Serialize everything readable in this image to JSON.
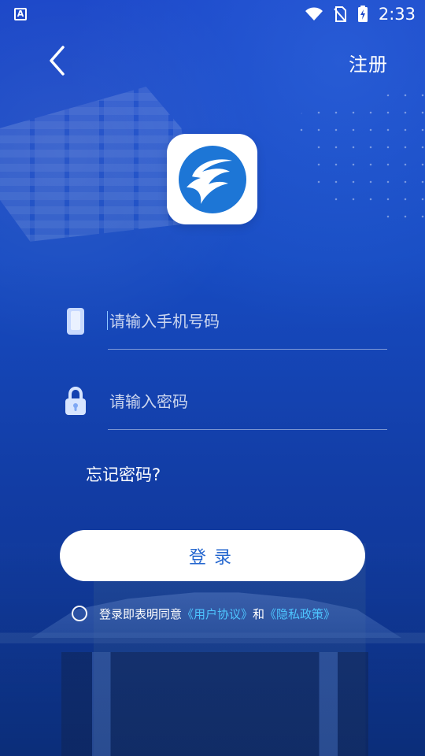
{
  "status_bar": {
    "app_icon": "A",
    "time": "2:33"
  },
  "header": {
    "register_label": "注册"
  },
  "brand": {
    "logo_icon": "swoosh-logo"
  },
  "form": {
    "phone_placeholder": "请输入手机号码",
    "password_placeholder": "请输入密码",
    "forgot_password_label": "忘记密码?",
    "login_button_label": "登录"
  },
  "agreement": {
    "prefix": "登录即表明同意",
    "user_agreement": "《用户协议》",
    "conjunction": "和",
    "privacy_policy": "《隐私政策》"
  },
  "colors": {
    "background_top": "#1a46c8",
    "background_bottom": "#0e3692",
    "login_button_text": "#2567cf",
    "link": "#4ec5ff"
  }
}
